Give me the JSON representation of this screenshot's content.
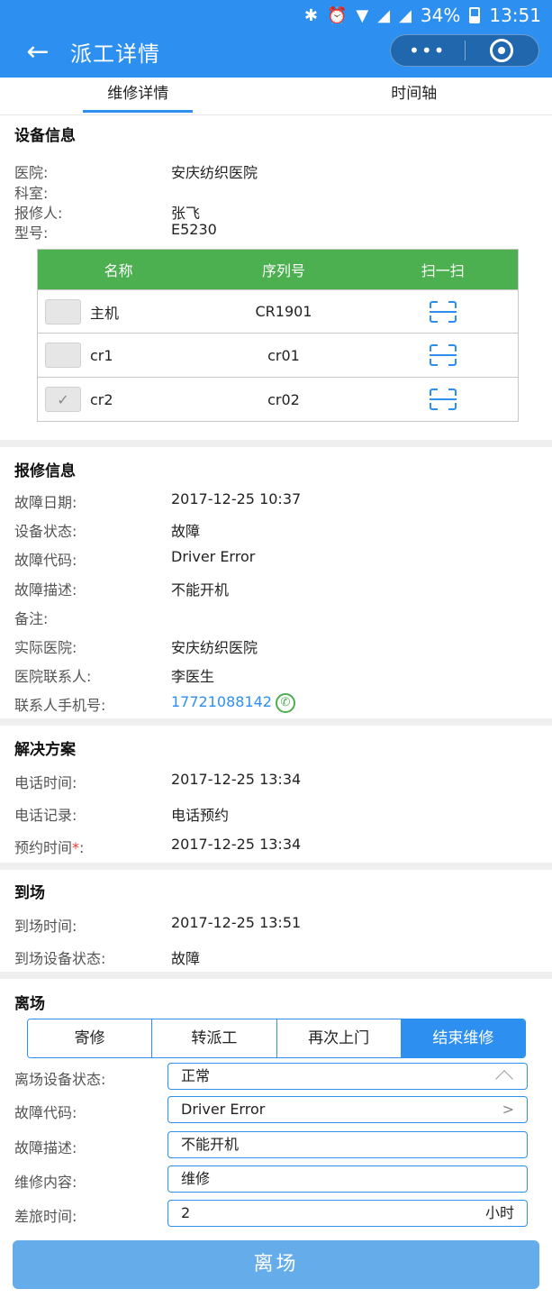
{
  "status_bar": {
    "battery": "34%",
    "time": "13:51"
  },
  "nav": {
    "back_label": "←",
    "title": "派工详情",
    "more_label": "•••"
  },
  "tabs": [
    {
      "label": "维修详情"
    },
    {
      "label": "时间轴"
    }
  ],
  "device_info": {
    "title": "设备信息",
    "rows": [
      {
        "label": "医院:",
        "value": "安庆纺织医院"
      },
      {
        "label": "科室:",
        "value": ""
      },
      {
        "label": "报修人:",
        "value": "张飞"
      },
      {
        "label": "型号:",
        "value": "E5230"
      }
    ],
    "table": {
      "headers": [
        "名称",
        "序列号",
        "扫一扫"
      ],
      "rows": [
        {
          "name": "主机",
          "serial": "CR1901",
          "checked": false
        },
        {
          "name": "cr1",
          "serial": "cr01",
          "checked": false
        },
        {
          "name": "cr2",
          "serial": "cr02",
          "checked": true
        }
      ],
      "header_color": "#4caf50"
    }
  },
  "repair_info": {
    "title": "报修信息",
    "rows": [
      {
        "label": "故障日期:",
        "value": "2017-12-25 10:37"
      },
      {
        "label": "设备状态:",
        "value": "故障"
      },
      {
        "label": "故障代码:",
        "value": "Driver Error"
      },
      {
        "label": "故障描述:",
        "value": "不能开机"
      },
      {
        "label": "备注:",
        "value": ""
      },
      {
        "label": "实际医院:",
        "value": "安庆纺织医院"
      },
      {
        "label": "医院联系人:",
        "value": "李医生"
      },
      {
        "label": "联系人手机号:",
        "value": "17721088142"
      }
    ]
  },
  "solution": {
    "title": "解决方案",
    "rows": [
      {
        "label": "电话时间:",
        "value": "2017-12-25 13:34"
      },
      {
        "label": "电话记录:",
        "value": "电话预约"
      },
      {
        "label": "预约时间",
        "required": "*",
        "colon": ":",
        "value": "2017-12-25 13:34"
      }
    ]
  },
  "arrival": {
    "title": "到场",
    "rows": [
      {
        "label": "到场时间:",
        "value": "2017-12-25 13:51"
      },
      {
        "label": "到场设备状态:",
        "value": "故障"
      }
    ]
  },
  "departure": {
    "title": "离场",
    "segments": [
      "寄修",
      "转派工",
      "再次上门",
      "结束维修"
    ],
    "active_segment": "结束维修",
    "fields": [
      {
        "label": "离场设备状态:",
        "value": "正常"
      },
      {
        "label": "故障代码:",
        "value": "Driver Error",
        "arrow": ">"
      },
      {
        "label": "故障描述:",
        "value": "不能开机"
      },
      {
        "label": "维修内容:",
        "value": "维修"
      },
      {
        "label": "差旅时间:",
        "value": "2",
        "unit": "小时"
      }
    ]
  },
  "submit_label": "离场",
  "colors": {
    "primary": "#2d8ff0",
    "submit": "#64acea",
    "table_header": "#4caf50"
  }
}
